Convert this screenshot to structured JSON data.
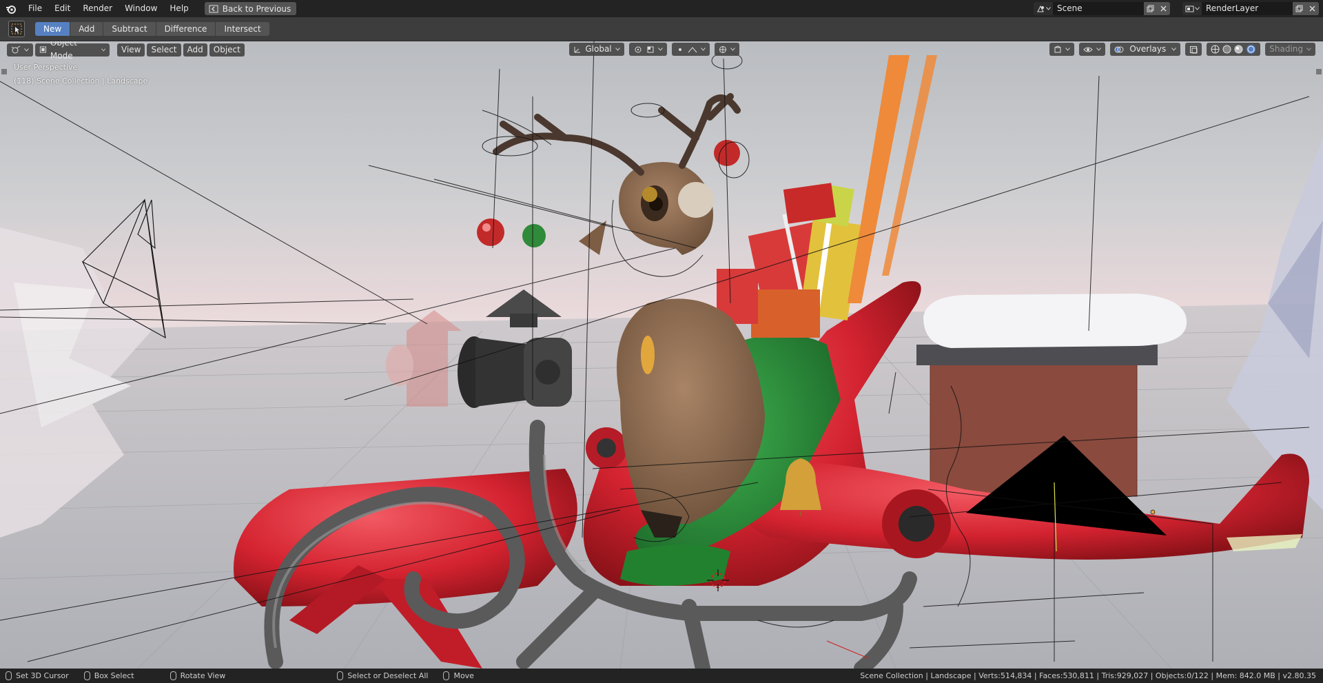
{
  "topbar": {
    "menus": [
      "File",
      "Edit",
      "Render",
      "Window",
      "Help"
    ],
    "back_label": "Back to Previous",
    "scene_name": "Scene",
    "render_layer": "RenderLayer"
  },
  "toolrow": {
    "booleans": [
      "New",
      "Add",
      "Subtract",
      "Difference",
      "Intersect"
    ],
    "active": "New"
  },
  "viewport": {
    "mode": "Object Mode",
    "menus": [
      "View",
      "Select",
      "Add",
      "Object"
    ],
    "orientation": "Global",
    "overlays_label": "Overlays",
    "shading_label": "Shading",
    "perspective": "User Perspective",
    "collection_info": "(118) Scene Collection | Landscape"
  },
  "statusbar": {
    "hints": [
      "Set 3D Cursor",
      "Box Select",
      "Rotate View",
      "Select or Deselect All",
      "Move"
    ],
    "stats": "Scene Collection | Landscape | Verts:514,834 | Faces:530,811 | Tris:929,027 | Objects:0/122 | Mem: 842.0 MB | v2.80.35"
  },
  "colors": {
    "accent": "#5680c2",
    "sleigh_red": "#d42330",
    "metal": "#5a5a5a",
    "reindeer": "#8a6a4e",
    "green_cloth": "#2f8a3a"
  }
}
